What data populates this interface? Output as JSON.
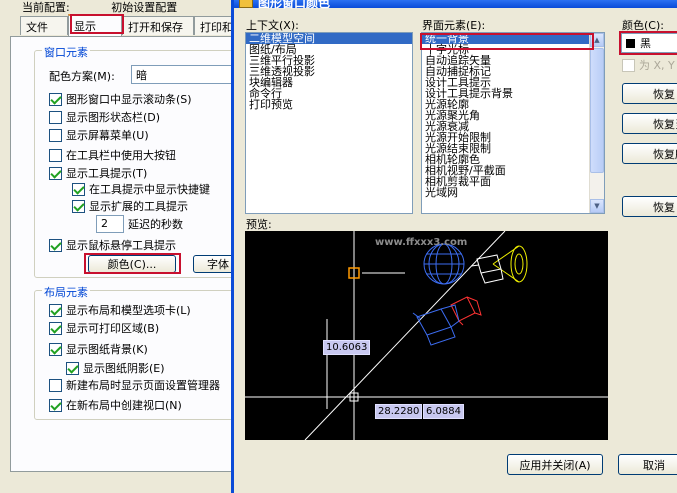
{
  "left_dialog": {
    "current_config_label": "当前配置:",
    "current_config_value": "初始设置配置",
    "tabs": [
      {
        "label": "文件",
        "active": false
      },
      {
        "label": "显示",
        "active": true
      },
      {
        "label": "打开和保存",
        "active": false
      },
      {
        "label": "打印和",
        "active": false
      }
    ],
    "window_elements": {
      "title": "窗口元素",
      "color_scheme_label": "配色方案(M):",
      "color_scheme_value": "暗",
      "checkboxes": [
        {
          "label": "图形窗口中显示滚动条(S)",
          "checked": true
        },
        {
          "label": "显示图形状态栏(D)",
          "checked": false
        },
        {
          "label": "显示屏幕菜单(U)",
          "checked": false
        },
        {
          "label": "在工具栏中使用大按钮",
          "checked": false
        },
        {
          "label": "显示工具提示(T)",
          "checked": true
        },
        {
          "label": "在工具提示中显示快捷键",
          "checked": true
        },
        {
          "label": "显示扩展的工具提示",
          "checked": true
        }
      ],
      "delay_value": "2",
      "delay_label": "延迟的秒数",
      "rollover_label": "显示鼠标悬停工具提示",
      "rollover_checked": true,
      "colors_button": "颜色(C)...",
      "fonts_button": "字体"
    },
    "layout_elements": {
      "title": "布局元素",
      "checkboxes": [
        {
          "label": "显示布局和模型选项卡(L)",
          "checked": true
        },
        {
          "label": "显示可打印区域(B)",
          "checked": true
        },
        {
          "label": "显示图纸背景(K)",
          "checked": true
        },
        {
          "label": "显示图纸阴影(E)",
          "checked": true
        },
        {
          "label": "新建布局时显示页面设置管理器",
          "checked": false
        },
        {
          "label": "在新布局中创建视口(N)",
          "checked": true
        }
      ]
    }
  },
  "right_dialog": {
    "title": "图形窗口颜色",
    "context_label": "上下文(X):",
    "context_items": [
      "二维模型空间",
      "图纸/布局",
      "三维平行投影",
      "三维透视投影",
      "块编辑器",
      "命令行",
      "打印预览"
    ],
    "context_selected": 0,
    "element_label": "界面元素(E):",
    "element_items": [
      "统一背景",
      "十字光标",
      "自动追踪矢量",
      "自动捕捉标记",
      "设计工具提示",
      "设计工具提示背景",
      "光源轮廓",
      "光源聚光角",
      "光源衰减",
      "光源开始限制",
      "光源结束限制",
      "相机轮廓色",
      "相机视野/平截面",
      "相机剪裁平面",
      "光域网"
    ],
    "element_selected": 0,
    "color_label": "颜色(C):",
    "color_value": "黑",
    "color_swatch": "#000000",
    "tint_label": "为 X, Y",
    "restore_buttons": [
      "恢复",
      "恢复当",
      "恢复所",
      "恢复"
    ],
    "preview_label": "预览:",
    "watermark": "www.ffxxx3.com",
    "coord_labels": [
      "10.6063",
      "28.2280",
      "6.0884"
    ],
    "apply_close_button": "应用并关闭(A)",
    "cancel_button": "取消"
  },
  "colors": {
    "xp_blue": "#0a4bd8",
    "highlight": "#316ac5",
    "annotation_red": "#c8102e",
    "tab_orange": "#e68b2c",
    "group_title": "#0046d5"
  }
}
